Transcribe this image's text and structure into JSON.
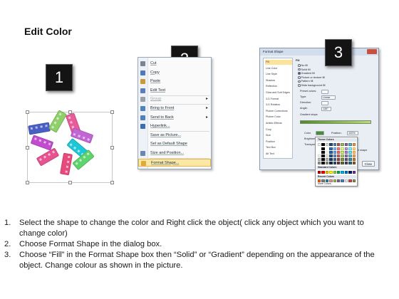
{
  "page": {
    "title": "Edit Color"
  },
  "badges": [
    "1",
    "2",
    "3"
  ],
  "context_menu": {
    "items": [
      {
        "label": "Cut",
        "icon": "scissors-icon",
        "enabled": true,
        "submenu": false
      },
      {
        "label": "Copy",
        "icon": "copy-icon",
        "enabled": true,
        "submenu": false
      },
      {
        "label": "Paste",
        "icon": "paste-icon",
        "enabled": true,
        "submenu": false
      },
      {
        "label": "Edit Text",
        "icon": "edit-text-icon",
        "enabled": true,
        "submenu": false
      },
      {
        "label": "Group",
        "icon": "group-icon",
        "enabled": false,
        "submenu": true
      },
      {
        "label": "Bring to Front",
        "icon": "bring-front-icon",
        "enabled": true,
        "submenu": true
      },
      {
        "label": "Send to Back",
        "icon": "send-back-icon",
        "enabled": true,
        "submenu": true
      },
      {
        "label": "Hyperlink...",
        "icon": "hyperlink-icon",
        "enabled": true,
        "submenu": false
      },
      {
        "label": "Save as Picture...",
        "icon": "",
        "enabled": true,
        "submenu": false
      },
      {
        "label": "Set as Default Shape",
        "icon": "",
        "enabled": true,
        "submenu": false
      },
      {
        "label": "Size and Position...",
        "icon": "size-icon",
        "enabled": true,
        "submenu": false
      },
      {
        "label": "Format Shape...",
        "icon": "format-shape-icon",
        "enabled": true,
        "submenu": false,
        "highlighted": true
      }
    ]
  },
  "format_dialog": {
    "title": "Format Shape",
    "nav": [
      "Fill",
      "Line Color",
      "Line Style",
      "Shadow",
      "Reflection",
      "Glow and Soft Edges",
      "3-D Format",
      "3-D Rotation",
      "Picture Corrections",
      "Picture Color",
      "Artistic Effects",
      "Crop",
      "Size",
      "Position",
      "Text Box",
      "Alt Text"
    ],
    "selected_nav": "Fill",
    "panel_heading": "Fill",
    "fill_options": [
      "No fill",
      "Solid fill",
      "Gradient fill",
      "Picture or texture fill",
      "Pattern fill",
      "Slide background fill"
    ],
    "selected_fill": "Gradient fill",
    "fields": {
      "preset": "Preset colors:",
      "type": "Type:",
      "type_value": "Linear",
      "direction": "Direction:",
      "angle": "Angle:",
      "angle_value": "135°",
      "gradient_stops": "Gradient stops",
      "color": "Color",
      "position": "Position:",
      "position_value": "100%",
      "brightness": "Brightness:",
      "transparency": "Transparency:",
      "rotate": "Rotate with shape"
    },
    "close_label": "Close"
  },
  "palette": {
    "theme_label": "Theme Colors",
    "standard_label": "Standard Colors",
    "recent_label": "Recent Colors",
    "more_label": "More Colors...",
    "theme_top": [
      "#ffffff",
      "#000000",
      "#eeece1",
      "#1f497d",
      "#4f81bd",
      "#c0504d",
      "#9bbb59",
      "#8064a2",
      "#4bacc6",
      "#f79646"
    ],
    "standard": [
      "#c00000",
      "#ff0000",
      "#ffc000",
      "#ffff00",
      "#92d050",
      "#00b050",
      "#00b0f0",
      "#0070c0",
      "#002060",
      "#7030a0"
    ],
    "recent": [
      "#e46c0a",
      "#7f7f7f",
      "#31859c",
      "#d99694",
      "#9bbb59",
      "#8064a2",
      "#4f81bd",
      "#f2f2f2",
      "#c0504d",
      "#948a54"
    ]
  },
  "instructions": [
    {
      "num": "1.",
      "text": "Select the shape to change the color and Right click the object( click any object which you want to change color)"
    },
    {
      "num": "2.",
      "text": "Choose Format Shape in the dialog box."
    },
    {
      "num": "3.",
      "text": "Choose “Fill” in the Format Shape box then “Solid” or “Gradient” depending on the appearance of the object. Change colour as shown in the picture."
    }
  ]
}
